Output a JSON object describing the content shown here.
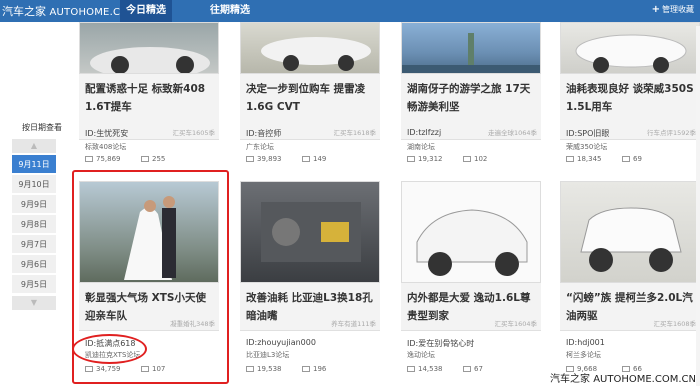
{
  "header": {
    "logo": "汽车之家",
    "domain": "AUTOHOME.COM.CN",
    "tabs": [
      {
        "label": "今日精选"
      },
      {
        "label": "往期精选"
      }
    ],
    "manage": "管理收藏"
  },
  "sidebar": {
    "title": "按日期查看",
    "up": "▲",
    "down": "▼",
    "dates": [
      "9月11日",
      "9月10日",
      "9月9日",
      "9月8日",
      "9月7日",
      "9月6日",
      "9月5日"
    ]
  },
  "cards": [
    {
      "title": "配置诱惑十足 标致新408 1.6T提车",
      "tag": "汇买车1605季",
      "id": "ID:生忧死安",
      "forum": "标致408论坛",
      "views": "75,869",
      "replies": "255"
    },
    {
      "title": "决定一步到位购车 提雷凌1.6G CVT",
      "tag": "汇买车1618季",
      "id": "ID:音控师",
      "forum": "广东论坛",
      "views": "39,893",
      "replies": "149"
    },
    {
      "title": "湖南伢子的游学之旅 17天畅游美利坚",
      "tag": "走遍全球1064季",
      "id": "ID:tzlfzzj",
      "forum": "湖南论坛",
      "views": "19,312",
      "replies": "102"
    },
    {
      "title": "油耗表现良好 谈荣威350S 1.5L用车",
      "tag": "行车点评1592季",
      "id": "ID:SPO旧眼",
      "forum": "荣威350论坛",
      "views": "18,345",
      "replies": "69"
    },
    {
      "title": "彰显强大气场 XTS小天使迎亲车队",
      "tag": "凝重婚礼348季",
      "id": "ID:抵满点618",
      "forum": "凯迪拉克XTS论坛",
      "views": "34,759",
      "replies": "107"
    },
    {
      "title": "改善油耗 比亚迪L3换18孔暗油嘴",
      "tag": "养车有道111季",
      "id": "ID:zhouyujian000",
      "forum": "比亚迪L3论坛",
      "views": "19,538",
      "replies": "196"
    },
    {
      "title": "内外都是大爱 逸动1.6L尊贵型到家",
      "tag": "汇买车1604季",
      "id": "ID:爱在别骨铭心时",
      "forum": "逸动论坛",
      "views": "14,538",
      "replies": "67"
    },
    {
      "title": "“闪螃”族 提柯兰多2.0L汽油两驱",
      "tag": "汇买车1608季",
      "id": "ID:hdj001",
      "forum": "柯兰多论坛",
      "views": "9,668",
      "replies": "66"
    }
  ],
  "watermark": "汽车之家 AUTOHOME.COM.CN",
  "colors": {
    "topbar": "#2f6fb3",
    "active_tab": "#1f5394",
    "active_date": "#3a7fd0",
    "highlight": "#e02020"
  }
}
